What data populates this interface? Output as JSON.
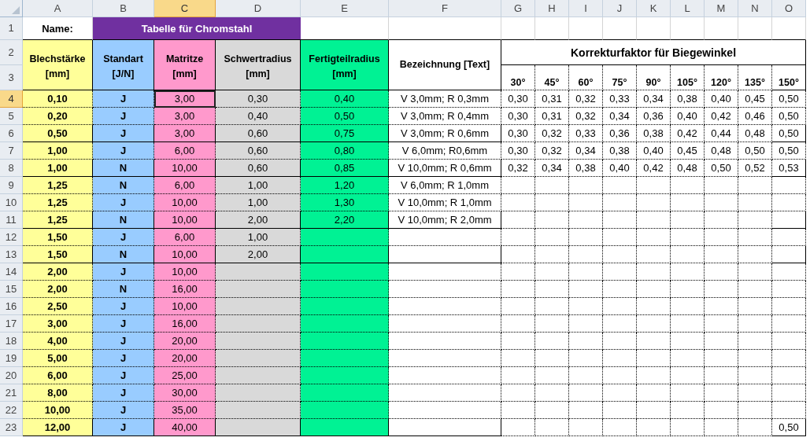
{
  "column_headers": [
    {
      "label": "A",
      "selected": false
    },
    {
      "label": "B",
      "selected": false
    },
    {
      "label": "C",
      "selected": true
    },
    {
      "label": "D",
      "selected": false
    },
    {
      "label": "E",
      "selected": false
    },
    {
      "label": "F",
      "selected": false
    },
    {
      "label": "G",
      "selected": false
    },
    {
      "label": "H",
      "selected": false
    },
    {
      "label": "I",
      "selected": false
    },
    {
      "label": "J",
      "selected": false
    },
    {
      "label": "K",
      "selected": false
    },
    {
      "label": "L",
      "selected": false
    },
    {
      "label": "M",
      "selected": false
    },
    {
      "label": "N",
      "selected": false
    },
    {
      "label": "O",
      "selected": false
    }
  ],
  "row_headers": [
    {
      "label": "1",
      "selected": false
    },
    {
      "label": "2",
      "selected": false
    },
    {
      "label": "3",
      "selected": false
    },
    {
      "label": "4",
      "selected": true
    },
    {
      "label": "5",
      "selected": false
    },
    {
      "label": "6",
      "selected": false
    },
    {
      "label": "7",
      "selected": false
    },
    {
      "label": "8",
      "selected": false
    },
    {
      "label": "9",
      "selected": false
    },
    {
      "label": "10",
      "selected": false
    },
    {
      "label": "11",
      "selected": false
    },
    {
      "label": "12",
      "selected": false
    },
    {
      "label": "13",
      "selected": false
    },
    {
      "label": "14",
      "selected": false
    },
    {
      "label": "15",
      "selected": false
    },
    {
      "label": "16",
      "selected": false
    },
    {
      "label": "17",
      "selected": false
    },
    {
      "label": "18",
      "selected": false
    },
    {
      "label": "19",
      "selected": false
    },
    {
      "label": "20",
      "selected": false
    },
    {
      "label": "21",
      "selected": false
    },
    {
      "label": "22",
      "selected": false
    },
    {
      "label": "23",
      "selected": false
    }
  ],
  "title_row": {
    "name_label": "Name:",
    "table_title": "Tabelle für Chromstahl"
  },
  "header": {
    "columns": [
      {
        "label": "Blechstärke",
        "unit": "[mm]",
        "color": "#ffff99"
      },
      {
        "label": "Standart",
        "unit": "[J/N]",
        "color": "#99ccff"
      },
      {
        "label": "Matritze",
        "unit": "[mm]",
        "color": "#ff99cc"
      },
      {
        "label": "Schwertradius",
        "unit": "[mm]",
        "color": "#d9d9d9"
      },
      {
        "label": "Fertigteilradius",
        "unit": "[mm]",
        "color": "#00f294"
      }
    ],
    "description": "Bezeichnung [Text]",
    "correction_title": "Korrekturfaktor für Biegewinkel",
    "angles": [
      "30°",
      "45°",
      "60°",
      "75°",
      "90°",
      "105°",
      "120°",
      "135°",
      "150°"
    ]
  },
  "rows": [
    {
      "cells": [
        "0,10",
        "J",
        "3,00",
        "0,30",
        "0,40"
      ],
      "bezeichnung": "V 3,0mm; R 0,3mm",
      "factors": [
        "0,30",
        "0,31",
        "0,32",
        "0,33",
        "0,34",
        "0,38",
        "0,40",
        "0,45",
        "0,50"
      ],
      "group_end": false
    },
    {
      "cells": [
        "0,20",
        "J",
        "3,00",
        "0,40",
        "0,50"
      ],
      "bezeichnung": "V 3,0mm; R 0,4mm",
      "factors": [
        "0,30",
        "0,31",
        "0,32",
        "0,34",
        "0,36",
        "0,40",
        "0,42",
        "0,46",
        "0,50"
      ],
      "group_end": false
    },
    {
      "cells": [
        "0,50",
        "J",
        "3,00",
        "0,60",
        "0,75"
      ],
      "bezeichnung": "V 3,0mm; R 0,6mm",
      "factors": [
        "0,30",
        "0,32",
        "0,33",
        "0,36",
        "0,38",
        "0,42",
        "0,44",
        "0,48",
        "0,50"
      ],
      "group_end": true
    },
    {
      "cells": [
        "1,00",
        "J",
        "6,00",
        "0,60",
        "0,80"
      ],
      "bezeichnung": "V 6,0mm; R0,6mm",
      "factors": [
        "0,30",
        "0,32",
        "0,34",
        "0,38",
        "0,40",
        "0,45",
        "0,48",
        "0,50",
        "0,50"
      ],
      "group_end": false
    },
    {
      "cells": [
        "1,00",
        "N",
        "10,00",
        "0,60",
        "0,85"
      ],
      "bezeichnung": "V 10,0mm; R 0,6mm",
      "factors": [
        "0,32",
        "0,34",
        "0,38",
        "0,40",
        "0,42",
        "0,48",
        "0,50",
        "0,52",
        "0,53"
      ],
      "group_end": true
    },
    {
      "cells": [
        "1,25",
        "N",
        "6,00",
        "1,00",
        "1,20"
      ],
      "bezeichnung": "V 6,0mm; R 1,0mm",
      "group_end": false
    },
    {
      "cells": [
        "1,25",
        "J",
        "10,00",
        "1,00",
        "1,30"
      ],
      "bezeichnung": "V 10,0mm; R 1,0mm",
      "group_end": false
    },
    {
      "cells": [
        "1,25",
        "N",
        "10,00",
        "2,00",
        "2,20"
      ],
      "bezeichnung": "V 10,0mm; R 2,0mm",
      "group_end": true
    },
    {
      "cells": [
        "1,50",
        "J",
        "6,00",
        "1,00"
      ],
      "group_end": false
    },
    {
      "cells": [
        "1,50",
        "N",
        "10,00",
        "2,00"
      ],
      "group_end": true
    },
    {
      "cells": [
        "2,00",
        "J",
        "10,00"
      ],
      "group_end": false
    },
    {
      "cells": [
        "2,00",
        "N",
        "16,00"
      ],
      "group_end": false
    },
    {
      "cells": [
        "2,50",
        "J",
        "10,00"
      ],
      "group_end": false
    },
    {
      "cells": [
        "3,00",
        "J",
        "16,00"
      ],
      "group_end": false
    },
    {
      "cells": [
        "4,00",
        "J",
        "20,00"
      ],
      "group_end": false
    },
    {
      "cells": [
        "5,00",
        "J",
        "20,00"
      ],
      "group_end": false
    },
    {
      "cells": [
        "6,00",
        "J",
        "25,00"
      ],
      "group_end": false
    },
    {
      "cells": [
        "8,00",
        "J",
        "30,00"
      ],
      "group_end": false
    },
    {
      "cells": [
        "10,00",
        "J",
        "35,00"
      ],
      "group_end": false
    },
    {
      "cells": [
        "12,00",
        "J",
        "40,00"
      ],
      "factors": [
        "0,50"
      ],
      "group_end": true
    }
  ]
}
